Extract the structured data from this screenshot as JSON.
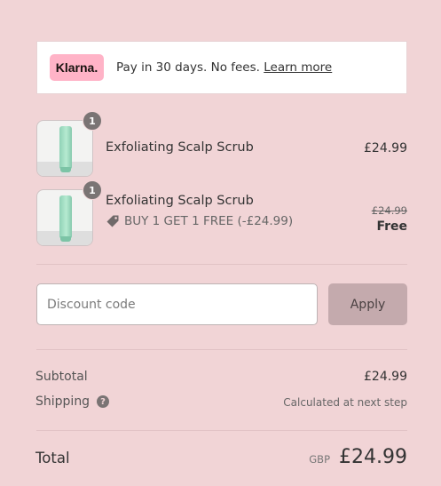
{
  "klarna": {
    "logo": "Klarna.",
    "text": "Pay in 30 days. No fees.",
    "link": "Learn more",
    "badge_color": "#ffb3c7"
  },
  "items": [
    {
      "quantity": "1",
      "name": "Exfoliating Scalp Scrub",
      "price": "£24.99"
    },
    {
      "quantity": "1",
      "name": "Exfoliating Scalp Scrub",
      "promo": "BUY 1 GET 1 FREE (-£24.99)",
      "original_price": "£24.99",
      "price": "Free"
    }
  ],
  "discount": {
    "placeholder": "Discount code",
    "value": "",
    "button": "Apply"
  },
  "summary": {
    "subtotal_label": "Subtotal",
    "subtotal_value": "£24.99",
    "shipping_label": "Shipping",
    "shipping_help": "?",
    "shipping_value": "Calculated at next step",
    "total_label": "Total",
    "currency": "GBP",
    "total_value": "£24.99"
  },
  "colors": {
    "background": "#f1d4d6",
    "apply_button": "#c4aaad",
    "product_tube": "#8fd2b6"
  },
  "icons": {
    "tag": "tag-icon",
    "help": "question-circle-icon"
  }
}
